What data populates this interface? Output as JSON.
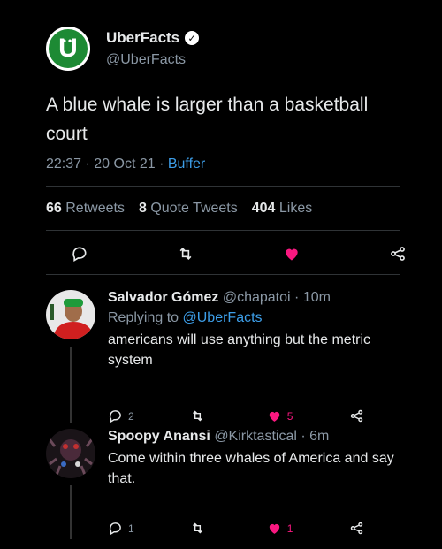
{
  "tweet": {
    "display_name": "UberFacts",
    "handle": "@UberFacts",
    "avatar_letter": "U",
    "text": "A blue whale is larger than a basketball court",
    "time": "22:37 · 20 Oct 21 · ",
    "source": "Buffer",
    "retweets_count": "66",
    "retweets_label": "Retweets",
    "quotes_count": "8",
    "quotes_label": "Quote Tweets",
    "likes_count": "404",
    "likes_label": "Likes",
    "liked": true
  },
  "replies": [
    {
      "name": "Salvador Gómez",
      "handle": "@chapatoi",
      "time": "· 10m",
      "replying_prefix": "Replying to ",
      "replying_to": "@UberFacts",
      "text": "americans will use anything but the metric system",
      "reply_count": "2",
      "retweet_count": "",
      "like_count": "5"
    },
    {
      "name": "Spoopy Anansi",
      "handle": "@Kirktastical",
      "time": "· 6m",
      "text": "Come within three whales of America and say that.",
      "reply_count": "1",
      "retweet_count": "",
      "like_count": "1"
    }
  ],
  "icons": [
    "verified-badge-icon",
    "reply-icon",
    "retweet-icon",
    "heart-icon",
    "share-icon"
  ],
  "colors": {
    "background": "#000000",
    "accent_blue": "#3d9ee8",
    "like_pink": "#f91880",
    "muted": "#8b98a5",
    "brand_green": "#1d8a34"
  }
}
